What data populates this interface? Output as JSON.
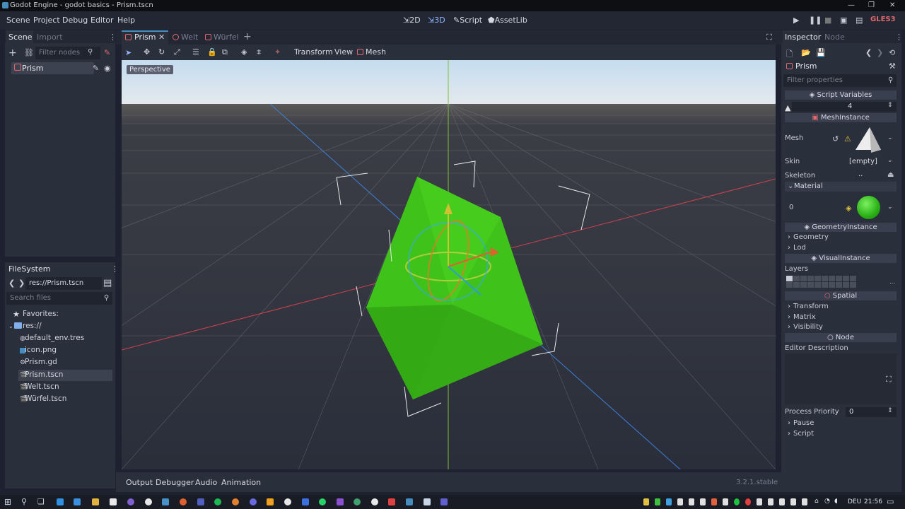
{
  "window": {
    "title": "Godot Engine - godot basics - Prism.tscn"
  },
  "menus": [
    "Scene",
    "Project",
    "Debug",
    "Editor",
    "Help"
  ],
  "modes": {
    "m2d": "2D",
    "m3d": "3D",
    "script": "Script",
    "assetlib": "AssetLib"
  },
  "renderer": "GLES3",
  "scene_dock": {
    "tab_scene": "Scene",
    "tab_import": "Import",
    "filter_placeholder": "Filter nodes",
    "root_node": "Prism"
  },
  "filesystem": {
    "title": "FileSystem",
    "path": "res://Prism.tscn",
    "search_placeholder": "Search files",
    "favorites": "Favorites:",
    "root": "res://",
    "files": [
      "default_env.tres",
      "icon.png",
      "Prism.gd",
      "Prism.tscn",
      "Welt.tscn",
      "Würfel.tscn"
    ],
    "selected_index": 3
  },
  "scene_tabs": [
    "Prism",
    "Welt",
    "Würfel"
  ],
  "toolbar": {
    "transform": "Transform",
    "view": "View",
    "mesh": "Mesh"
  },
  "viewport": {
    "perspective_label": "Perspective"
  },
  "bottom_tabs": [
    "Output",
    "Debugger",
    "Audio",
    "Animation"
  ],
  "version": "3.2.1.stable",
  "inspector": {
    "tab_inspector": "Inspector",
    "tab_node": "Node",
    "object_name": "Prism",
    "filter_placeholder": "Filter properties",
    "sec_script_vars": "Script Variables",
    "script_var_value": "4",
    "sec_meshinstance": "MeshInstance",
    "mesh_label": "Mesh",
    "skin_label": "Skin",
    "skin_value": "[empty]",
    "skeleton_label": "Skeleton",
    "skeleton_value": "..",
    "material_label": "Material",
    "material_index": "0",
    "sec_geometry": "GeometryInstance",
    "geometry": "Geometry",
    "lod": "Lod",
    "sec_visual": "VisualInstance",
    "layers_label": "Layers",
    "sec_spatial": "Spatial",
    "transform": "Transform",
    "matrix": "Matrix",
    "visibility": "Visibility",
    "sec_node": "Node",
    "editor_desc": "Editor Description",
    "process_priority_label": "Process Priority",
    "process_priority_value": "0",
    "pause": "Pause",
    "script": "Script"
  },
  "taskbar": {
    "lang": "DEU",
    "time": "21:56"
  },
  "colors": {
    "accent": "#478cbf",
    "mesh_green": "#3fc21a",
    "selection": "#3d4250"
  }
}
